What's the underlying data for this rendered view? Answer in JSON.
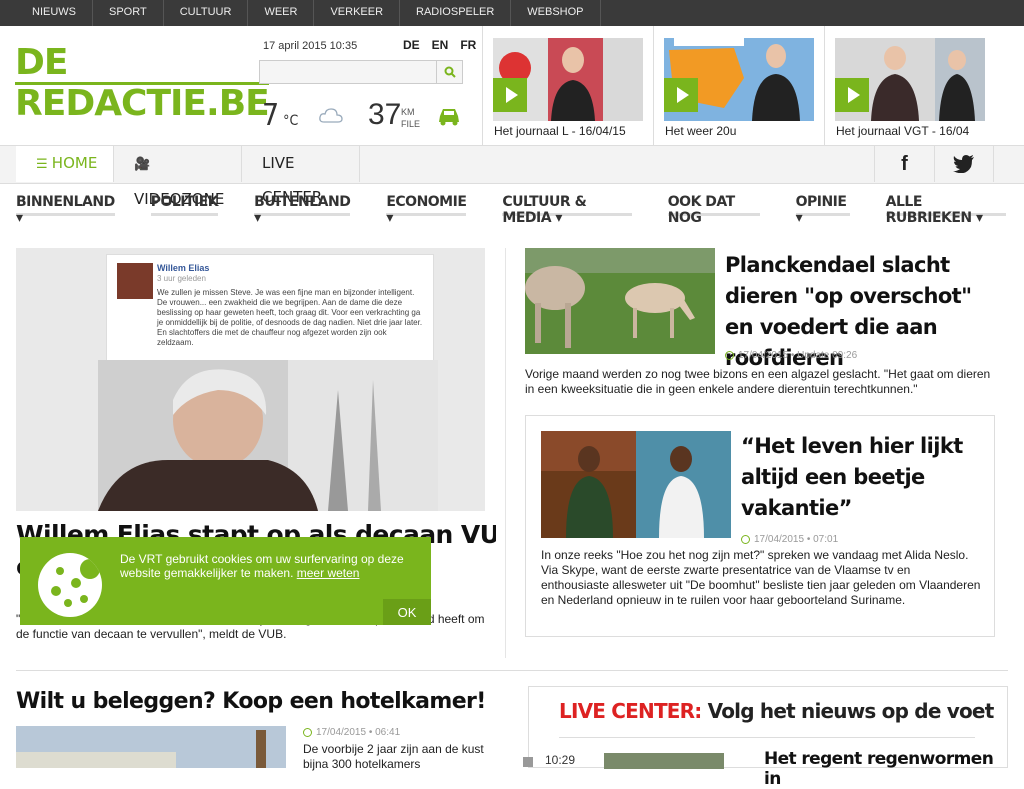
{
  "topnav": [
    "NIEUWS",
    "SPORT",
    "CULTUUR",
    "WEER",
    "VERKEER",
    "RADIOSPELER",
    "WEBSHOP"
  ],
  "logo": {
    "line1": "DE",
    "line2": "REDACTIE.BE"
  },
  "header": {
    "date": "17 april 2015 10:35",
    "langs": [
      "DE",
      "EN",
      "FR"
    ],
    "search_placeholder": "",
    "temperature": "7",
    "temp_unit": "°C",
    "traffic_km": "37",
    "traffic_unit_1": "KM",
    "traffic_unit_2": "FILE"
  },
  "video_tiles": [
    {
      "caption": "Het journaal L - 16/04/15"
    },
    {
      "caption": "Het weer 20u"
    },
    {
      "caption": "Het journaal VGT - 16/04"
    }
  ],
  "secnav": {
    "home": "HOME",
    "videozone": "VIDEOZONE",
    "live": "LIVE CENTER"
  },
  "categories": [
    "BINNENLAND ▾",
    "POLITIEK",
    "BUITENLAND ▾",
    "ECONOMIE ▾",
    "CULTUUR & MEDIA ▾",
    "OOK DAT NOG",
    "OPINIE ▾",
    "ALLE RUBRIEKEN ▾"
  ],
  "hero": {
    "fb_name": "Willem Elias",
    "fb_sub": "3 uur geleden",
    "fb_text": "We zullen je missen Steve. Je was een fijne man en bijzonder intelligent. De vrouwen... een zwakheid die we begrijpen. Aan de dame die deze beslissing op haar geweten heeft, toch graag dit. Voor een verkrachting ga je onmiddellijk bij de politie, of desnoods de dag nadien. Niet drie jaar later. En slachtoffers die met de chauffeur nog afgezet worden zijn ook zeldzaam.",
    "headline": "Willem Elias stapt op als decaan VUB na",
    "headline2": "c",
    "desc": "\"...Steve Stevaert, oordeelt Willem Elias dat hij niet langer de onbesprokenheid heeft om de functie van decaan te vervullen\", meldt de VUB."
  },
  "article1": {
    "headline": "Planckendael slacht dieren \"op overschot\" en voedert die aan roofdieren",
    "date": "17/04/2015",
    "update": "Update 09:26",
    "desc": "Vorige maand werden zo nog twee bizons en een algazel geslacht. \"Het gaat om dieren in een kweeksituatie die in geen enkele andere dierentuin terechtkunnen.\""
  },
  "article2": {
    "headline": "“Het leven hier lijkt altijd een beetje vakantie”",
    "date": "17/04/2015",
    "time": "07:01",
    "desc": "In onze reeks \"Hoe zou het nog zijn met?\" spreken we vandaag met Alida Neslo. Via Skype, want de eerste zwarte presentatrice van de Vlaamse tv en enthousiaste allesweter uit \"De boomhut\" besliste tien jaar geleden om Vlaanderen en Nederland opnieuw in te ruilen voor haar geboorteland Suriname."
  },
  "article3": {
    "headline": "Wilt u beleggen? Koop een hotelkamer!",
    "date": "17/04/2015",
    "time": "06:41",
    "desc": "De voorbije 2 jaar zijn aan de kust bijna 300 hotelkamers"
  },
  "livecenter": {
    "label": "LIVE CENTER:",
    "title": "Volg het nieuws op de voet",
    "time": "10:29",
    "item": "Het regent regenwormen in"
  },
  "cookie": {
    "text": "De VRT gebruikt cookies om uw surfervaring op deze website gemakkelijker te maken.",
    "link": "meer weten",
    "ok": "OK"
  },
  "colors": {
    "accent": "#7ab51d",
    "live_red": "#dd2222",
    "topnav_bg": "#3a3a3a"
  }
}
